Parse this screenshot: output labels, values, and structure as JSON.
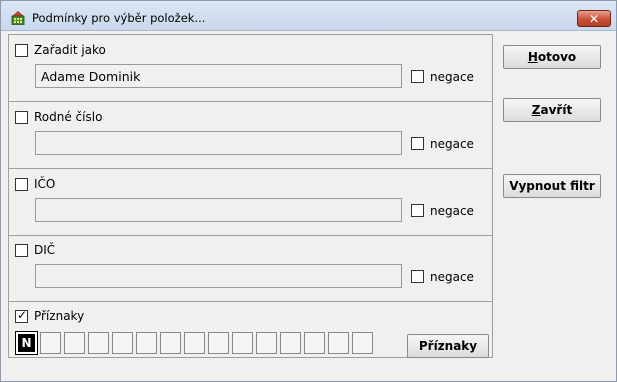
{
  "window": {
    "title": "Podmínky pro výběr položek...",
    "close_glyph": "✕",
    "icon": "grid-house-icon"
  },
  "sections": [
    {
      "label": "Zařadit jako",
      "checked": false,
      "value": "Adame Dominik",
      "negation_label": "negace",
      "negation_checked": false
    },
    {
      "label": "Rodné číslo",
      "checked": false,
      "value": "",
      "negation_label": "negace",
      "negation_checked": false
    },
    {
      "label": "IČO",
      "checked": false,
      "value": "",
      "negation_label": "negace",
      "negation_checked": false
    },
    {
      "label": "DIČ",
      "checked": false,
      "value": "",
      "negation_label": "negace",
      "negation_checked": false
    }
  ],
  "flags": {
    "label": "Příznaky",
    "checked": true,
    "boxes": [
      "N",
      "",
      "",
      "",
      "",
      "",
      "",
      "",
      "",
      "",
      "",
      "",
      "",
      "",
      "",
      ""
    ],
    "button_label": "Příznaky"
  },
  "buttons": {
    "done": {
      "prefix": "",
      "mnemonic": "H",
      "rest": "otovo"
    },
    "close": {
      "prefix": "",
      "mnemonic": "Z",
      "rest": "avřít"
    },
    "filter_off": "Vypnout filtr"
  },
  "colors": {
    "titlebar": "#c9d8ec",
    "close_button": "#c75138",
    "active_flag": "#000000"
  }
}
